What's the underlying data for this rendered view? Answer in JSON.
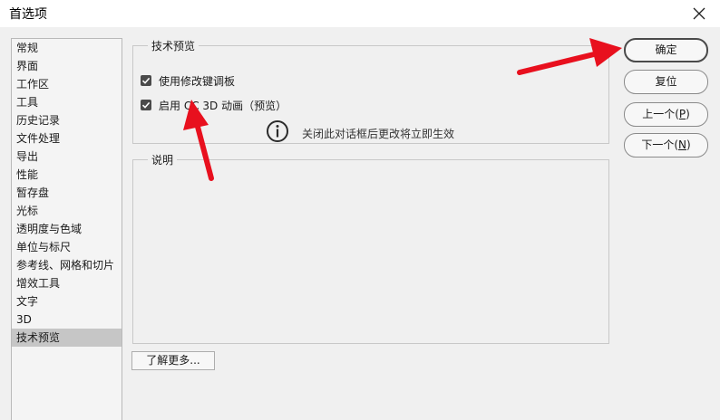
{
  "window": {
    "title": "首选项",
    "close_icon": "close-icon"
  },
  "sidebar": {
    "items": [
      {
        "label": "常规"
      },
      {
        "label": "界面"
      },
      {
        "label": "工作区"
      },
      {
        "label": "工具"
      },
      {
        "label": "历史记录"
      },
      {
        "label": "文件处理"
      },
      {
        "label": "导出"
      },
      {
        "label": "性能"
      },
      {
        "label": "暂存盘"
      },
      {
        "label": "光标"
      },
      {
        "label": "透明度与色域"
      },
      {
        "label": "单位与标尺"
      },
      {
        "label": "参考线、网格和切片"
      },
      {
        "label": "增效工具"
      },
      {
        "label": "文字"
      },
      {
        "label": "3D"
      },
      {
        "label": "技术预览"
      }
    ],
    "active_index": 16
  },
  "tech_preview": {
    "legend": "技术预览",
    "options": [
      {
        "label": "使用修改键调板",
        "checked": true
      },
      {
        "label": "启用 CC 3D 动画（预览）",
        "checked": true
      }
    ],
    "note": "关闭此对话框后更改将立即生效",
    "note_icon": "info-icon"
  },
  "description": {
    "legend": "说明"
  },
  "learn_more_label": "了解更多...",
  "buttons": {
    "ok": "确定",
    "reset": "复位",
    "prev": {
      "text": "上一个(",
      "key": "P",
      "suffix": ")"
    },
    "next": {
      "text": "下一个(",
      "key": "N",
      "suffix": ")"
    }
  },
  "annotation_color": "#e8101e"
}
